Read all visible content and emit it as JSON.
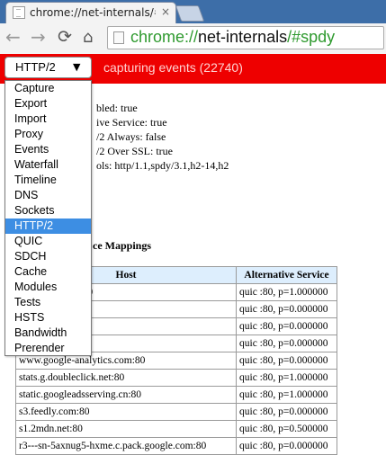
{
  "tab": {
    "title": "chrome://net-internals/#",
    "close": "×"
  },
  "toolbar": {
    "back_icon": "←",
    "forward_icon": "→",
    "reload_icon": "⟳",
    "home_icon": "⌂",
    "url_scheme": "chrome://",
    "url_host": "net-internals",
    "url_rest": "/#spdy"
  },
  "status_bar": {
    "selected_view": "HTTP/2",
    "dropdown_arrow": "▼",
    "capture_status": "capturing events (22740)",
    "color": "#ee0000"
  },
  "dropdown": {
    "items": [
      "Capture",
      "Export",
      "Import",
      "Proxy",
      "Events",
      "Waterfall",
      "Timeline",
      "DNS",
      "Sockets",
      "HTTP/2",
      "QUIC",
      "SDCH",
      "Cache",
      "Modules",
      "Tests",
      "HSTS",
      "Bandwidth",
      "Prerender"
    ],
    "selected": "HTTP/2"
  },
  "spdy_info": {
    "lines": [
      "bled: true",
      "ive Service: true",
      "/2 Always: false",
      "/2 Over SSL: true",
      "ols: http/1.1,spdy/3.1,h2-14,h2"
    ]
  },
  "alt_service": {
    "heading": "ce Mappings",
    "columns": [
      "Host",
      "Alternative Service"
    ],
    "rows": [
      [
        "gmanager.com:80",
        "quic :80, p=1.000000"
      ],
      [
        "om:80",
        "quic :80, p=0.000000"
      ],
      [
        "om.hk:80",
        "quic :80, p=0.000000"
      ],
      [
        ":80",
        "quic :80, p=0.000000"
      ],
      [
        "www.google-analytics.com:80",
        "quic :80, p=0.000000"
      ],
      [
        "stats.g.doubleclick.net:80",
        "quic :80, p=1.000000"
      ],
      [
        "static.googleadsserving.cn:80",
        "quic :80, p=1.000000"
      ],
      [
        "s3.feedly.com:80",
        "quic :80, p=0.000000"
      ],
      [
        "s1.2mdn.net:80",
        "quic :80, p=0.500000"
      ],
      [
        "r3---sn-5axnug5-hxme.c.pack.google.com:80",
        "quic :80, p=0.000000"
      ]
    ]
  }
}
